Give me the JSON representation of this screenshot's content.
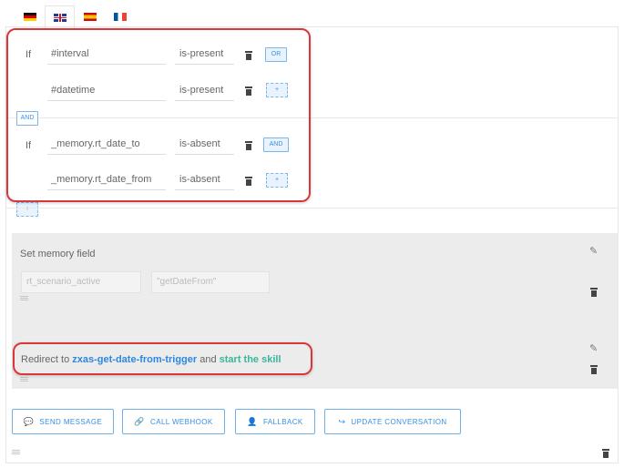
{
  "languages": [
    {
      "code": "de",
      "icon": "flag-germany-icon"
    },
    {
      "code": "gb",
      "icon": "flag-uk-icon",
      "active": true
    },
    {
      "code": "es",
      "icon": "flag-spain-icon"
    },
    {
      "code": "fr",
      "icon": "flag-france-icon"
    }
  ],
  "conditions": {
    "group1": {
      "if_label": "If",
      "rows": [
        {
          "field": "#interval",
          "operator": "is-present",
          "logic": "OR"
        },
        {
          "field": "#datetime",
          "operator": "is-present",
          "logic": "+"
        }
      ]
    },
    "between_label": "AND",
    "group2": {
      "if_label": "If",
      "rows": [
        {
          "field": "_memory.rt_date_to",
          "operator": "is-absent",
          "logic": "AND"
        },
        {
          "field": "_memory.rt_date_from",
          "operator": "is-absent",
          "logic": "+"
        }
      ]
    },
    "add_group_label": "+"
  },
  "memory_panel": {
    "title": "Set memory field",
    "key_placeholder": "rt_scenario_active",
    "value_placeholder": "\"getDateFrom\""
  },
  "redirect_panel": {
    "prefix": "Redirect to",
    "target": "zxas-get-date-from-trigger",
    "middle": "and",
    "action": "start the skill"
  },
  "action_buttons": [
    {
      "label": "SEND MESSAGE",
      "icon": "chat-bubble-icon",
      "glyph": "💬"
    },
    {
      "label": "CALL WEBHOOK",
      "icon": "link-icon",
      "glyph": "🔗"
    },
    {
      "label": "FALLBACK",
      "icon": "person-icon",
      "glyph": "👤"
    },
    {
      "label": "UPDATE CONVERSATION",
      "icon": "arrow-right-icon",
      "glyph": "↪"
    }
  ],
  "colors": {
    "accent": "#3b8ee0",
    "highlight": "#d9373c",
    "skill_action": "#3bb59a"
  }
}
